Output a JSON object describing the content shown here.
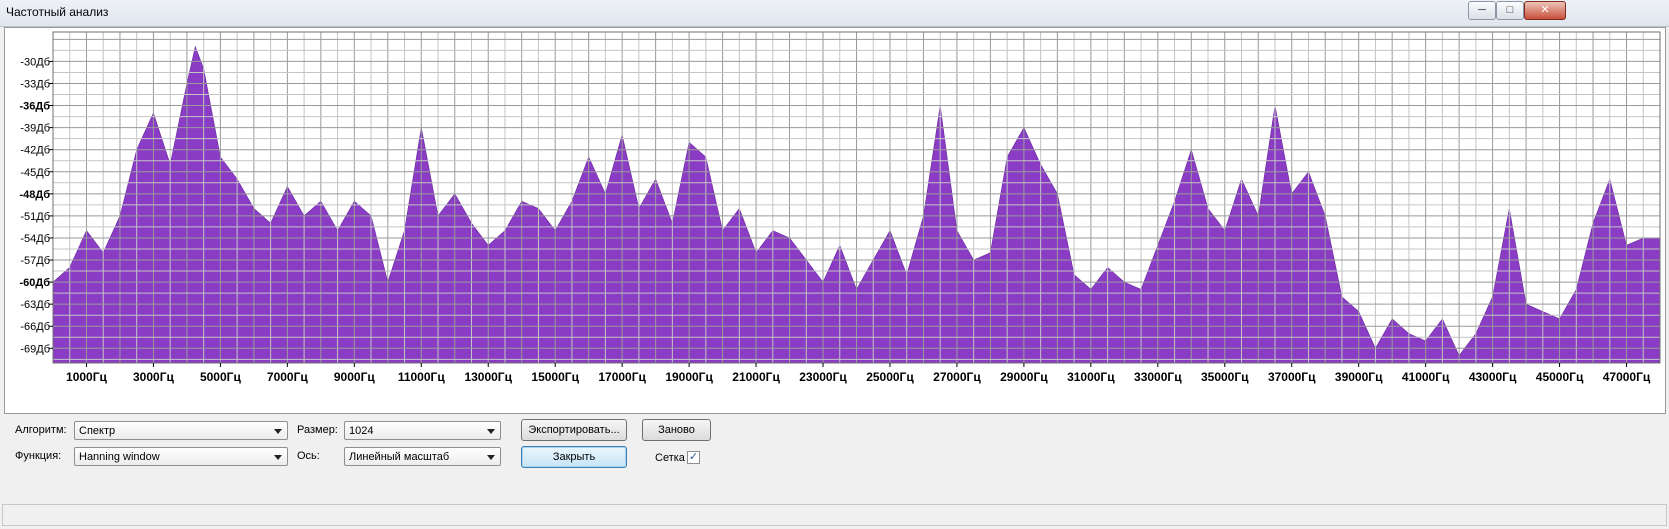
{
  "window": {
    "title": "Частотный анализ",
    "buttons": [
      {
        "name": "minimize-button",
        "label": "─"
      },
      {
        "name": "maximize-button",
        "label": "□"
      },
      {
        "name": "close-button",
        "label": "✕"
      }
    ]
  },
  "chart_data": {
    "type": "area",
    "color": "#8a3dc4",
    "grid": true,
    "ylim": [
      -71,
      -26
    ],
    "xlim": [
      0,
      48000
    ],
    "y_ticks": [
      {
        "label": "-30Дб",
        "value": -30,
        "bold": false
      },
      {
        "label": "-33Дб",
        "value": -33,
        "bold": false
      },
      {
        "label": "-36Дб",
        "value": -36,
        "bold": true
      },
      {
        "label": "-39Дб",
        "value": -39,
        "bold": false
      },
      {
        "label": "-42Дб",
        "value": -42,
        "bold": false
      },
      {
        "label": "-45Дб",
        "value": -45,
        "bold": false
      },
      {
        "label": "-48Дб",
        "value": -48,
        "bold": true
      },
      {
        "label": "-51Дб",
        "value": -51,
        "bold": false
      },
      {
        "label": "-54Дб",
        "value": -54,
        "bold": false
      },
      {
        "label": "-57Дб",
        "value": -57,
        "bold": false
      },
      {
        "label": "-60Дб",
        "value": -60,
        "bold": true
      },
      {
        "label": "-63Дб",
        "value": -63,
        "bold": false
      },
      {
        "label": "-66Дб",
        "value": -66,
        "bold": false
      },
      {
        "label": "-69Дб",
        "value": -69,
        "bold": false
      }
    ],
    "x_ticks": [
      {
        "label": "1000Гц",
        "value": 1000
      },
      {
        "label": "3000Гц",
        "value": 3000
      },
      {
        "label": "5000Гц",
        "value": 5000
      },
      {
        "label": "7000Гц",
        "value": 7000
      },
      {
        "label": "9000Гц",
        "value": 9000
      },
      {
        "label": "11000Гц",
        "value": 11000
      },
      {
        "label": "13000Гц",
        "value": 13000
      },
      {
        "label": "15000Гц",
        "value": 15000
      },
      {
        "label": "17000Гц",
        "value": 17000
      },
      {
        "label": "19000Гц",
        "value": 19000
      },
      {
        "label": "21000Гц",
        "value": 21000
      },
      {
        "label": "23000Гц",
        "value": 23000
      },
      {
        "label": "25000Гц",
        "value": 25000
      },
      {
        "label": "27000Гц",
        "value": 27000
      },
      {
        "label": "29000Гц",
        "value": 29000
      },
      {
        "label": "31000Гц",
        "value": 31000
      },
      {
        "label": "33000Гц",
        "value": 33000
      },
      {
        "label": "35000Гц",
        "value": 35000
      },
      {
        "label": "37000Гц",
        "value": 37000
      },
      {
        "label": "39000Гц",
        "value": 39000
      },
      {
        "label": "41000Гц",
        "value": 41000
      },
      {
        "label": "43000Гц",
        "value": 43000
      },
      {
        "label": "45000Гц",
        "value": 45000
      },
      {
        "label": "47000Гц",
        "value": 47000
      }
    ],
    "x": [
      0,
      500,
      1000,
      1500,
      2000,
      2500,
      3000,
      3500,
      4000,
      4250,
      4500,
      5000,
      5500,
      6000,
      6500,
      7000,
      7500,
      8000,
      8500,
      9000,
      9500,
      10000,
      10500,
      11000,
      11500,
      12000,
      12500,
      13000,
      13500,
      14000,
      14500,
      15000,
      15500,
      16000,
      16500,
      17000,
      17500,
      18000,
      18500,
      19000,
      19500,
      20000,
      20500,
      21000,
      21500,
      22000,
      22500,
      23000,
      23500,
      24000,
      24500,
      25000,
      25500,
      26000,
      26500,
      27000,
      27500,
      28000,
      28500,
      29000,
      29500,
      30000,
      30500,
      31000,
      31500,
      32000,
      32500,
      33000,
      33500,
      34000,
      34500,
      35000,
      35500,
      36000,
      36500,
      37000,
      37500,
      38000,
      38500,
      39000,
      39500,
      40000,
      40500,
      41000,
      41500,
      42000,
      42500,
      43000,
      43500,
      44000,
      44500,
      45000,
      45500,
      46000,
      46500,
      47000,
      47500,
      48000
    ],
    "values": [
      -60,
      -58,
      -53,
      -56,
      -51,
      -42,
      -37,
      -44,
      -33,
      -28,
      -31,
      -43,
      -46,
      -50,
      -52,
      -47,
      -51,
      -49,
      -53,
      -49,
      -51,
      -60,
      -53,
      -39,
      -51,
      -48,
      -52,
      -55,
      -53,
      -49,
      -50,
      -53,
      -49,
      -43,
      -48,
      -40,
      -50,
      -46,
      -52,
      -41,
      -43,
      -53,
      -50,
      -56,
      -53,
      -54,
      -57,
      -60,
      -55,
      -61,
      -57,
      -53,
      -59,
      -51,
      -36,
      -53,
      -57,
      -56,
      -43,
      -39,
      -44,
      -48,
      -59,
      -61,
      -58,
      -60,
      -61,
      -55,
      -49,
      -42,
      -50,
      -53,
      -46,
      -51,
      -36,
      -48,
      -45,
      -51,
      -62,
      -64,
      -69,
      -65,
      -67,
      -68,
      -65,
      -70,
      -67,
      -62,
      -50,
      -63,
      -64,
      -65,
      -61,
      -52,
      -46,
      -55,
      -54,
      -54
    ]
  },
  "controls": {
    "algorithm_label": "Алгоритм:",
    "algorithm_value": "Спектр",
    "function_label": "Функция:",
    "function_value": "Hanning window",
    "size_label": "Размер:",
    "size_value": "1024",
    "axis_label": "Ось:",
    "axis_value": "Линейный масштаб",
    "export_button": "Экспортировать...",
    "replot_button": "Заново",
    "close_button": "Закрыть",
    "grid_label": "Сетка",
    "grid_checked": true,
    "grid_check_glyph": "✓"
  }
}
